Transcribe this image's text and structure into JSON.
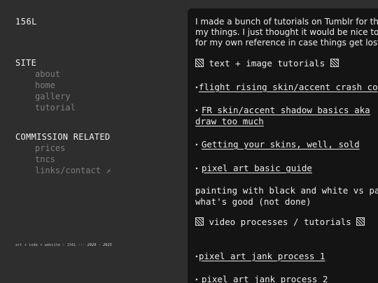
{
  "sidebar": {
    "site_title": "156L",
    "site_heading": "SITE",
    "site_links": [
      "about",
      "home",
      "gallery",
      "tutorial"
    ],
    "commission_heading": "COMMISSION RELATED",
    "commission_links": [
      "prices",
      "tncs",
      "links/contact ↗"
    ],
    "footer_prefix": "art + code + website : 156L ·:· ",
    "footer_years": "2020 - 2025"
  },
  "content": {
    "intro_lines": [
      "I made a bunch of tutorials on Tumblr for tho",
      "my things. I just thought it would be nice to a",
      "for my own reference in case things get lost!"
    ],
    "text_tutorials_heading": "text + image tutorials",
    "text_links": [
      {
        "arrow": "▸",
        "lines": [
          "flight rising skin/accent crash co"
        ]
      },
      {
        "arrow": "▸",
        "lines": [
          "FR skin/accent shadow basics aka",
          "draw too much"
        ]
      },
      {
        "arrow": "▸",
        "lines": [
          "Getting your skins, well, sold"
        ]
      },
      {
        "arrow": "▸",
        "lines": [
          "pixel art basic guide"
        ]
      }
    ],
    "note_lines": [
      "painting with black and white vs pa",
      "what's good (not done)"
    ],
    "video_heading": "video processes / tutorials",
    "video_links": [
      {
        "arrow": "▸",
        "lines": [
          "pixel art jank process 1"
        ]
      },
      {
        "arrow": "▸",
        "lines": [
          "pixel art jank process 2"
        ]
      }
    ]
  }
}
